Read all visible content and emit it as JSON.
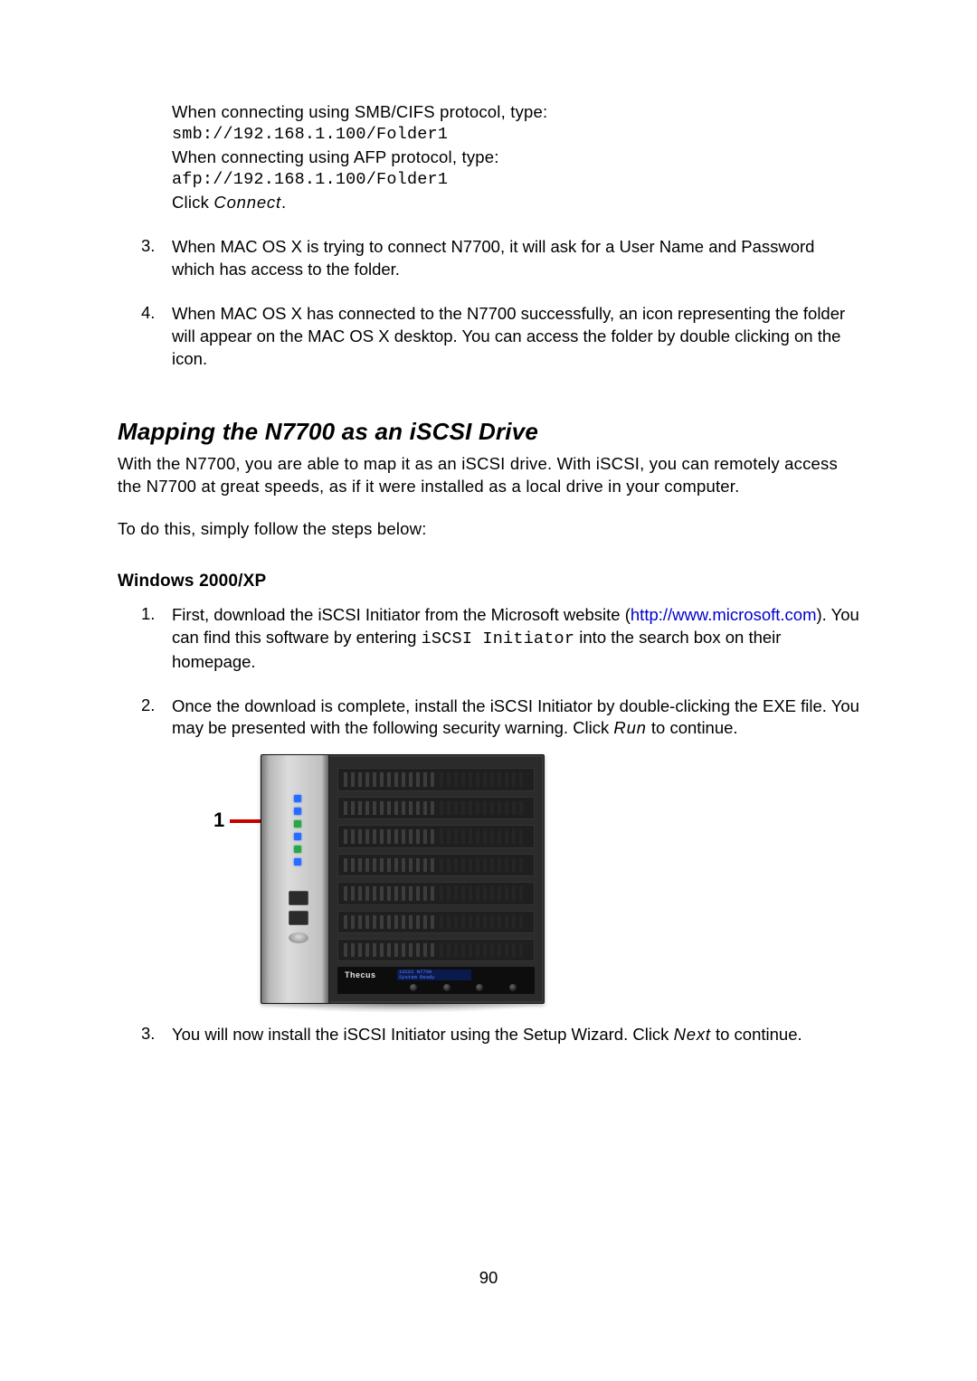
{
  "top_block": {
    "line1": "When connecting using SMB/CIFS protocol, type:",
    "mono1": "smb://192.168.1.100/Folder1",
    "line2": "When connecting using AFP protocol, type:",
    "mono2": "afp://192.168.1.100/Folder1",
    "click_prefix": "Click ",
    "click_action": "Connect",
    "click_suffix": "."
  },
  "mac_steps": {
    "s3_num": "3.",
    "s3_text": "When MAC OS X is trying to connect N7700, it will ask for a User Name and Password which has access to the folder.",
    "s4_num": "4.",
    "s4_text": "When MAC OS X has connected to the N7700 successfully, an icon representing the folder will appear on the MAC OS X desktop. You can access the folder by double clicking on the icon."
  },
  "section_title": "Mapping the N7700 as an iSCSI Drive",
  "section_intro": "With the N7700, you are able to map it as an iSCSI drive. With iSCSI, you can remotely access the N7700 at great speeds, as if it were installed as a local drive in your computer.",
  "section_followup": "To do this, simply follow the steps below:",
  "subsection_title": "Windows 2000/XP",
  "win_steps": {
    "s1_num": "1.",
    "s1_a": "First, download the iSCSI Initiator from the Microsoft website (",
    "s1_link_text": "http://www.microsoft.com",
    "s1_link_href": "http://www.microsoft.com",
    "s1_b": "). You can find this software by entering ",
    "s1_mono": "iSCSI Initiator",
    "s1_c": " into the search box on their homepage.",
    "s2_num": "2.",
    "s2_a": "Once the download is complete, install the iSCSI Initiator by double-clicking the EXE file. You may be presented with the following security warning. Click ",
    "s2_em": "Run",
    "s2_b": " to continue.",
    "s3_num": "3.",
    "s3_a": "You will now install the iSCSI Initiator using the Setup Wizard. Click ",
    "s3_em": "Next",
    "s3_b": " to continue."
  },
  "device": {
    "callout": "1",
    "brand": "Thecus",
    "lcd_line": "iSCSI N7700\nSystem Ready"
  },
  "page_number": "90"
}
